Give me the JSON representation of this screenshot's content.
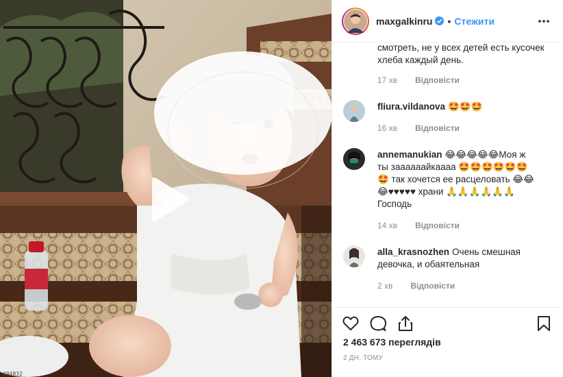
{
  "media": {
    "caption": "494832"
  },
  "post": {
    "owner_username": "maxgalkinru",
    "separator": "•",
    "follow_label": "Стежити",
    "views_text": "2 463 673 переглядів",
    "posted_ago": "2 ДН. ТОМУ"
  },
  "comments": [
    {
      "username": "",
      "text": "смотреть, не у всех детей есть кусочек хлеба каждый день.",
      "time": "17 хв",
      "reply_label": "Відповісти"
    },
    {
      "username": "fliura.vildanova",
      "text": "🤩🤩🤩",
      "time": "16 хв",
      "reply_label": "Відповісти"
    },
    {
      "username": "annemanukian",
      "text": "😂😂😂😂😂Моя ж ты заааааайкаааа 🤩🤩🤩🤩🤩🤩🤩 так хочется ее расцеловать 😂😂😂♥♥♥♥♥ храни 🙏🙏🙏🙏🙏🙏 Господь",
      "time": "14 хв",
      "reply_label": "Відповісти"
    },
    {
      "username": "alla_krasnozhen",
      "text": "Очень смешная девочка, и обаятельная",
      "time": "2 хв",
      "reply_label": "Відповісти"
    }
  ],
  "icons": {
    "like": "heart-icon",
    "comment": "comment-icon",
    "share": "share-icon",
    "save": "bookmark-icon",
    "more": "more-icon",
    "play": "play-icon"
  },
  "colors": {
    "link_blue": "#3897f0",
    "meta_gray": "#8e8e8e",
    "text": "#262626",
    "border": "#efefef"
  }
}
